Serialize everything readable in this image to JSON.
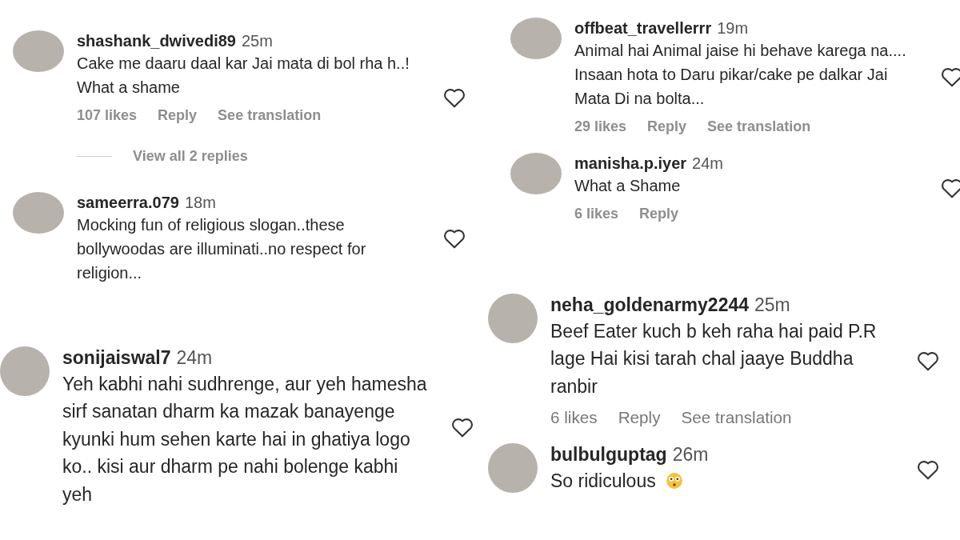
{
  "panels": [
    {
      "comments": [
        {
          "username": "shashank_dwivedi89",
          "time": "25m",
          "text": "Cake me daaru daal kar Jai mata di bol rha h..! What a shame",
          "likes": "107 likes",
          "reply": "Reply",
          "translate": "See translation",
          "replies": "View all 2 replies"
        },
        {
          "username": "sameerra.079",
          "time": "18m",
          "text": "Mocking fun of religious slogan..these bollywoodas are illuminati..no respect for religion..."
        }
      ]
    },
    {
      "comments": [
        {
          "username": "sonijaiswal7",
          "time": "24m",
          "text": "Yeh kabhi nahi sudhrenge, aur yeh hamesha sirf sanatan dharm ka mazak banayenge kyunki hum sehen karte hai in ghatiya logo ko.. kisi aur dharm pe nahi bolenge kabhi yeh"
        }
      ]
    },
    {
      "comments": [
        {
          "username": "offbeat_travellerrr",
          "time": "19m",
          "text": "Animal hai Animal jaise hi behave karega na.... Insaan hota to Daru pikar/cake pe dalkar Jai Mata Di na bolta...",
          "likes": "29 likes",
          "reply": "Reply",
          "translate": "See translation"
        },
        {
          "username": "manisha.p.iyer",
          "time": "24m",
          "text": "What a Shame",
          "likes": "6 likes",
          "reply": "Reply"
        }
      ]
    },
    {
      "comments": [
        {
          "username": "neha_goldenarmy2244",
          "time": "25m",
          "text": "Beef Eater kuch b keh raha hai paid P.R lage Hai kisi tarah chal jaaye Buddha ranbir",
          "likes": "6 likes",
          "reply": "Reply",
          "translate": "See translation"
        },
        {
          "username": "bulbulguptag",
          "time": "26m",
          "text": "So ridiculous",
          "kind": "emoji"
        }
      ]
    }
  ]
}
